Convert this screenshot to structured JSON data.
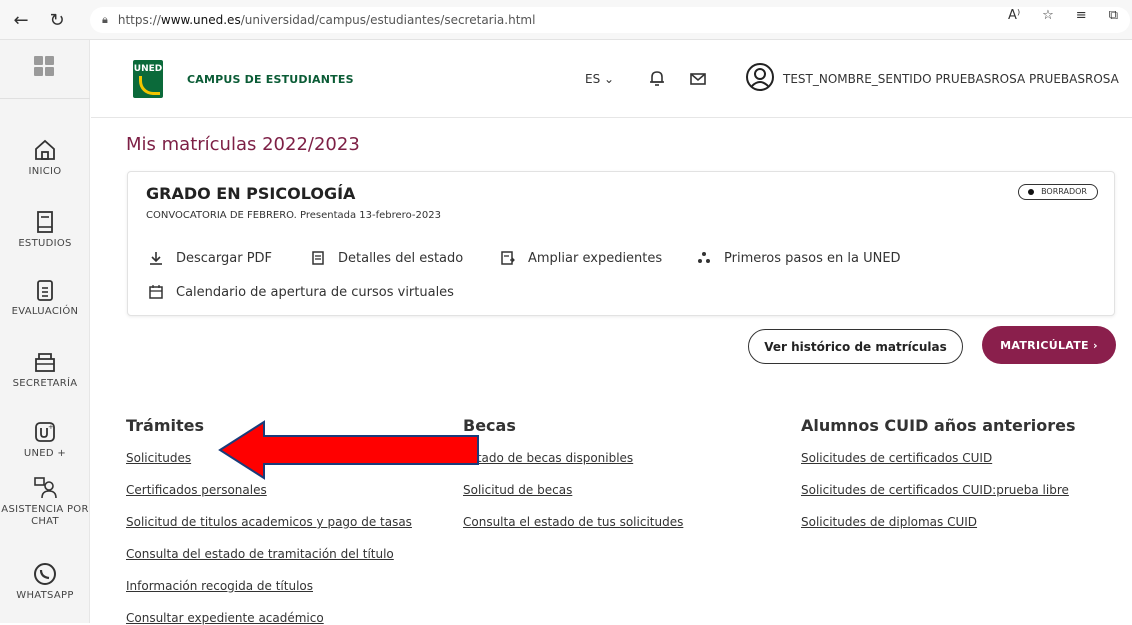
{
  "browser": {
    "url_prefix": "https://",
    "url_domain": "www.uned.es",
    "url_path": "/universidad/campus/estudiantes/secretaria.html"
  },
  "rail": {
    "items": [
      {
        "label": "INICIO",
        "icon": "home-icon"
      },
      {
        "label": "ESTUDIOS",
        "icon": "book-icon"
      },
      {
        "label": "EVALUACIÓN",
        "icon": "clipboard-icon"
      },
      {
        "label": "SECRETARÍA",
        "icon": "printer-icon"
      },
      {
        "label": "UNED +",
        "icon": "uned-plus-icon"
      },
      {
        "label": "ASISTENCIA POR CHAT",
        "icon": "chat-assist-icon"
      },
      {
        "label": "WHATSAPP",
        "icon": "whatsapp-icon"
      }
    ]
  },
  "header": {
    "logo_text": "UNED",
    "campus_title": "CAMPUS DE ESTUDIANTES",
    "language": "ES ⌄",
    "user_name": "TEST_NOMBRE_SENTIDO PRUEBASROSA PRUEBASROSA"
  },
  "main": {
    "page_title": "Mis matrículas 2022/2023",
    "card": {
      "title": "GRADO EN PSICOLOGÍA",
      "subtitle": "CONVOCATORIA DE FEBRERO. Presentada 13-febrero-2023",
      "badge": "BORRADOR",
      "actions": [
        "Descargar PDF",
        "Detalles del estado",
        "Ampliar expedientes",
        "Primeros pasos en la UNED",
        "Calendario de apertura de cursos virtuales"
      ]
    },
    "history_button": "Ver histórico de matrículas",
    "enroll_button": "MATRICÚLATE ›",
    "columns": [
      {
        "title": "Trámites",
        "links": [
          "Solicitudes",
          "Certificados personales",
          "Solicitud de titulos academicos y pago de tasas",
          "Consulta del estado de tramitación del título",
          "Información recogida de títulos",
          "Consultar expediente académico"
        ]
      },
      {
        "title": "Becas",
        "links": [
          "Estado de becas disponibles",
          "Solicitud de becas",
          "Consulta el estado de tus solicitudes"
        ]
      },
      {
        "title": "Alumnos CUID años anteriores",
        "links": [
          "Solicitudes de certificados CUID",
          "Solicitudes de certificados CUID:prueba libre",
          "Solicitudes de diplomas CUID"
        ]
      }
    ]
  },
  "colors": {
    "accent": "#8a1f4c",
    "title": "#7d1f45",
    "brand_green": "#0b6a3a",
    "annotation_arrow": "#ff0000"
  }
}
